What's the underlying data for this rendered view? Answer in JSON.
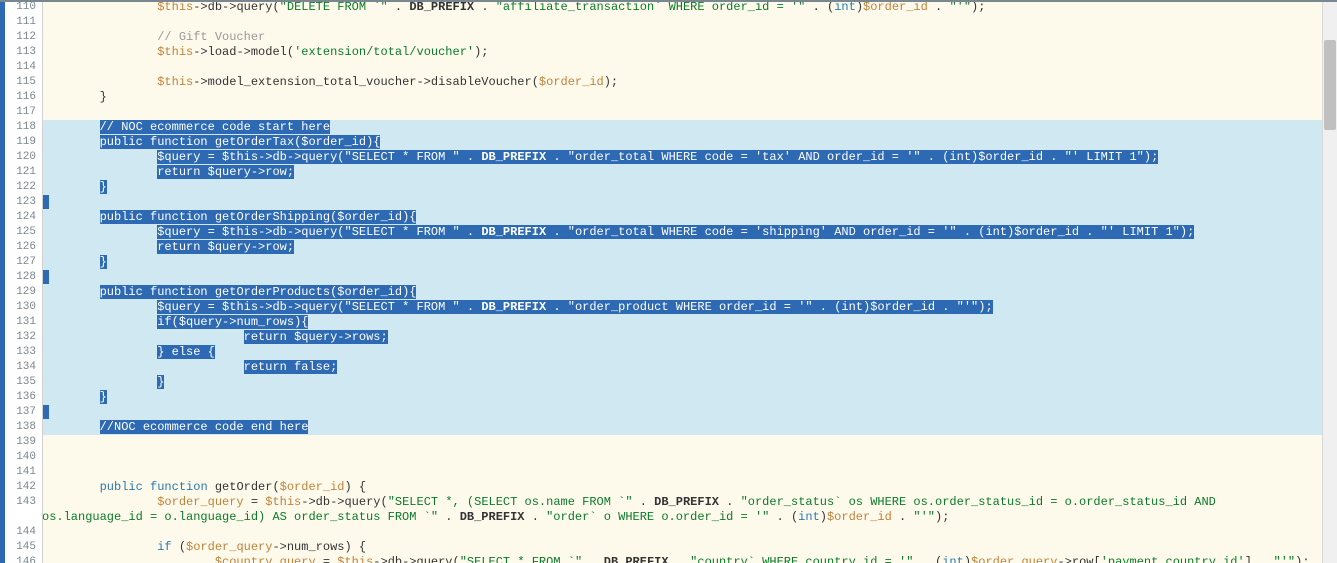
{
  "editor": {
    "first_line": 110,
    "selection_start": 118,
    "selection_end": 138,
    "lines": [
      {
        "n": 110,
        "indent": 16,
        "tokens": [
          [
            "var",
            "$this"
          ],
          [
            "op",
            "->"
          ],
          [
            "id",
            "db"
          ],
          [
            "op",
            "->"
          ],
          [
            "id",
            "query"
          ],
          [
            "op",
            "("
          ],
          [
            "str",
            "\"DELETE FROM `\""
          ],
          [
            "op",
            " . "
          ],
          [
            "const",
            "DB_PREFIX"
          ],
          [
            "op",
            " . "
          ],
          [
            "str",
            "\"affiliate_transaction` WHERE order_id = '\""
          ],
          [
            "op",
            " . ("
          ],
          [
            "kw",
            "int"
          ],
          [
            "op",
            ")"
          ],
          [
            "var",
            "$order_id"
          ],
          [
            "op",
            " . "
          ],
          [
            "str",
            "\"'\""
          ],
          [
            "op",
            ");"
          ]
        ]
      },
      {
        "n": 111,
        "indent": 0,
        "tokens": []
      },
      {
        "n": 112,
        "indent": 16,
        "tokens": [
          [
            "cm",
            "// Gift Voucher"
          ]
        ]
      },
      {
        "n": 113,
        "indent": 16,
        "tokens": [
          [
            "var",
            "$this"
          ],
          [
            "op",
            "->"
          ],
          [
            "id",
            "load"
          ],
          [
            "op",
            "->"
          ],
          [
            "id",
            "model"
          ],
          [
            "op",
            "("
          ],
          [
            "str",
            "'extension/total/voucher'"
          ],
          [
            "op",
            ");"
          ]
        ]
      },
      {
        "n": 114,
        "indent": 0,
        "tokens": []
      },
      {
        "n": 115,
        "indent": 16,
        "tokens": [
          [
            "var",
            "$this"
          ],
          [
            "op",
            "->"
          ],
          [
            "id",
            "model_extension_total_voucher"
          ],
          [
            "op",
            "->"
          ],
          [
            "id",
            "disableVoucher"
          ],
          [
            "op",
            "("
          ],
          [
            "var",
            "$order_id"
          ],
          [
            "op",
            ");"
          ]
        ]
      },
      {
        "n": 116,
        "indent": 8,
        "tokens": [
          [
            "op",
            "}"
          ]
        ]
      },
      {
        "n": 117,
        "indent": 0,
        "tokens": []
      },
      {
        "n": 118,
        "indent": 8,
        "hl": true,
        "tokens": [
          [
            "cm",
            "// NOC ecommerce code start here"
          ]
        ]
      },
      {
        "n": 119,
        "indent": 8,
        "hl": true,
        "tokens": [
          [
            "kw",
            "public function"
          ],
          [
            "txt",
            " "
          ],
          [
            "id",
            "getOrderTax"
          ],
          [
            "op",
            "("
          ],
          [
            "var",
            "$order_id"
          ],
          [
            "op",
            "){"
          ]
        ]
      },
      {
        "n": 120,
        "indent": 16,
        "hl": true,
        "tokens": [
          [
            "var",
            "$query"
          ],
          [
            "op",
            " = "
          ],
          [
            "var",
            "$this"
          ],
          [
            "op",
            "->"
          ],
          [
            "id",
            "db"
          ],
          [
            "op",
            "->"
          ],
          [
            "id",
            "query"
          ],
          [
            "op",
            "("
          ],
          [
            "str",
            "\"SELECT * FROM \""
          ],
          [
            "op",
            " . "
          ],
          [
            "const",
            "DB_PREFIX"
          ],
          [
            "op",
            " . "
          ],
          [
            "str",
            "\"order_total WHERE code = 'tax' AND order_id = '\""
          ],
          [
            "op",
            " . ("
          ],
          [
            "kw",
            "int"
          ],
          [
            "op",
            ")"
          ],
          [
            "var",
            "$order_id"
          ],
          [
            "op",
            " . "
          ],
          [
            "str",
            "\"' LIMIT 1\""
          ],
          [
            "op",
            ");"
          ]
        ]
      },
      {
        "n": 121,
        "indent": 16,
        "hl": true,
        "tokens": [
          [
            "kw",
            "return"
          ],
          [
            "txt",
            " "
          ],
          [
            "var",
            "$query"
          ],
          [
            "op",
            "->"
          ],
          [
            "id",
            "row"
          ],
          [
            "op",
            ";"
          ]
        ]
      },
      {
        "n": 122,
        "indent": 8,
        "hl": true,
        "tokens": [
          [
            "op",
            "}"
          ]
        ]
      },
      {
        "n": 123,
        "indent": 0,
        "hl": true,
        "tokens": []
      },
      {
        "n": 124,
        "indent": 8,
        "hl": true,
        "tokens": [
          [
            "kw",
            "public function"
          ],
          [
            "txt",
            " "
          ],
          [
            "id",
            "getOrderShipping"
          ],
          [
            "op",
            "("
          ],
          [
            "var",
            "$order_id"
          ],
          [
            "op",
            "){"
          ]
        ]
      },
      {
        "n": 125,
        "indent": 16,
        "hl": true,
        "tokens": [
          [
            "var",
            "$query"
          ],
          [
            "op",
            " = "
          ],
          [
            "var",
            "$this"
          ],
          [
            "op",
            "->"
          ],
          [
            "id",
            "db"
          ],
          [
            "op",
            "->"
          ],
          [
            "id",
            "query"
          ],
          [
            "op",
            "("
          ],
          [
            "str",
            "\"SELECT * FROM \""
          ],
          [
            "op",
            " . "
          ],
          [
            "const",
            "DB_PREFIX"
          ],
          [
            "op",
            " . "
          ],
          [
            "str",
            "\"order_total WHERE code = 'shipping' AND order_id = '\""
          ],
          [
            "op",
            " . ("
          ],
          [
            "kw",
            "int"
          ],
          [
            "op",
            ")"
          ],
          [
            "var",
            "$order_id"
          ],
          [
            "op",
            " . "
          ],
          [
            "str",
            "\"' LIMIT 1\""
          ],
          [
            "op",
            ");"
          ]
        ]
      },
      {
        "n": 126,
        "indent": 16,
        "hl": true,
        "tokens": [
          [
            "kw",
            "return"
          ],
          [
            "txt",
            " "
          ],
          [
            "var",
            "$query"
          ],
          [
            "op",
            "->"
          ],
          [
            "id",
            "row"
          ],
          [
            "op",
            ";"
          ]
        ]
      },
      {
        "n": 127,
        "indent": 8,
        "hl": true,
        "tokens": [
          [
            "op",
            "}"
          ]
        ]
      },
      {
        "n": 128,
        "indent": 0,
        "hl": true,
        "tokens": []
      },
      {
        "n": 129,
        "indent": 8,
        "hl": true,
        "tokens": [
          [
            "kw",
            "public function"
          ],
          [
            "txt",
            " "
          ],
          [
            "id",
            "getOrderProducts"
          ],
          [
            "op",
            "("
          ],
          [
            "var",
            "$order_id"
          ],
          [
            "op",
            "){"
          ]
        ]
      },
      {
        "n": 130,
        "indent": 16,
        "hl": true,
        "tokens": [
          [
            "var",
            "$query"
          ],
          [
            "op",
            " = "
          ],
          [
            "var",
            "$this"
          ],
          [
            "op",
            "->"
          ],
          [
            "id",
            "db"
          ],
          [
            "op",
            "->"
          ],
          [
            "id",
            "query"
          ],
          [
            "op",
            "("
          ],
          [
            "str",
            "\"SELECT * FROM \""
          ],
          [
            "op",
            " . "
          ],
          [
            "const",
            "DB_PREFIX"
          ],
          [
            "op",
            " . "
          ],
          [
            "str",
            "\"order_product WHERE order_id = '\""
          ],
          [
            "op",
            " . ("
          ],
          [
            "kw",
            "int"
          ],
          [
            "op",
            ")"
          ],
          [
            "var",
            "$order_id"
          ],
          [
            "op",
            " . "
          ],
          [
            "str",
            "\"'\""
          ],
          [
            "op",
            ");"
          ]
        ]
      },
      {
        "n": 131,
        "indent": 16,
        "hl": true,
        "tokens": [
          [
            "kw",
            "if"
          ],
          [
            "op",
            "("
          ],
          [
            "var",
            "$query"
          ],
          [
            "op",
            "->"
          ],
          [
            "id",
            "num_rows"
          ],
          [
            "op",
            "){"
          ]
        ]
      },
      {
        "n": 132,
        "indent": 28,
        "hl": true,
        "tokens": [
          [
            "kw",
            "return"
          ],
          [
            "txt",
            " "
          ],
          [
            "var",
            "$query"
          ],
          [
            "op",
            "->"
          ],
          [
            "id",
            "rows"
          ],
          [
            "op",
            ";"
          ]
        ]
      },
      {
        "n": 133,
        "indent": 16,
        "hl": true,
        "tokens": [
          [
            "op",
            "} "
          ],
          [
            "kw",
            "else"
          ],
          [
            "op",
            " {"
          ]
        ]
      },
      {
        "n": 134,
        "indent": 28,
        "hl": true,
        "tokens": [
          [
            "kw",
            "return false"
          ],
          [
            "op",
            ";"
          ]
        ]
      },
      {
        "n": 135,
        "indent": 16,
        "hl": true,
        "tokens": [
          [
            "op",
            "}"
          ]
        ]
      },
      {
        "n": 136,
        "indent": 8,
        "hl": true,
        "tokens": [
          [
            "op",
            "}"
          ]
        ]
      },
      {
        "n": 137,
        "indent": 0,
        "hl": true,
        "tokens": []
      },
      {
        "n": 138,
        "indent": 8,
        "hl": true,
        "tokens": [
          [
            "cm",
            "//NOC ecommerce code end here"
          ]
        ]
      },
      {
        "n": 139,
        "indent": 0,
        "tokens": []
      },
      {
        "n": 140,
        "indent": 0,
        "tokens": []
      },
      {
        "n": 141,
        "indent": 0,
        "tokens": []
      },
      {
        "n": 142,
        "indent": 8,
        "tokens": [
          [
            "kw",
            "public"
          ],
          [
            "txt",
            " "
          ],
          [
            "kw",
            "function"
          ],
          [
            "txt",
            " "
          ],
          [
            "id",
            "getOrder"
          ],
          [
            "op",
            "("
          ],
          [
            "var",
            "$order_id"
          ],
          [
            "op",
            ") {"
          ]
        ]
      },
      {
        "n": 143,
        "indent": 16,
        "tokens": [
          [
            "var",
            "$order_query"
          ],
          [
            "op",
            " = "
          ],
          [
            "var",
            "$this"
          ],
          [
            "op",
            "->"
          ],
          [
            "id",
            "db"
          ],
          [
            "op",
            "->"
          ],
          [
            "id",
            "query"
          ],
          [
            "op",
            "("
          ],
          [
            "str",
            "\"SELECT *, (SELECT os.name FROM `\""
          ],
          [
            "op",
            " . "
          ],
          [
            "const",
            "DB_PREFIX"
          ],
          [
            "op",
            " . "
          ],
          [
            "str",
            "\"order_status` os WHERE os.order_status_id = o.order_status_id AND os.language_id = o.language_id) AS order_status FROM `\""
          ],
          [
            "op",
            " . "
          ],
          [
            "const",
            "DB_PREFIX"
          ],
          [
            "op",
            " . "
          ],
          [
            "str",
            "\"order` o WHERE o.order_id = '\""
          ],
          [
            "op",
            " . ("
          ],
          [
            "kw",
            "int"
          ],
          [
            "op",
            ")"
          ],
          [
            "var",
            "$order_id"
          ],
          [
            "op",
            " . "
          ],
          [
            "str",
            "\"'\""
          ],
          [
            "op",
            ");"
          ]
        ]
      },
      {
        "n": 144,
        "indent": 0,
        "tokens": []
      },
      {
        "n": 145,
        "indent": 16,
        "tokens": [
          [
            "kw",
            "if"
          ],
          [
            "txt",
            " ("
          ],
          [
            "var",
            "$order_query"
          ],
          [
            "op",
            "->"
          ],
          [
            "id",
            "num_rows"
          ],
          [
            "op",
            ") {"
          ]
        ]
      },
      {
        "n": 146,
        "indent": 24,
        "tokens": [
          [
            "var",
            "$country_query"
          ],
          [
            "op",
            " = "
          ],
          [
            "var",
            "$this"
          ],
          [
            "op",
            "->"
          ],
          [
            "id",
            "db"
          ],
          [
            "op",
            "->"
          ],
          [
            "id",
            "query"
          ],
          [
            "op",
            "("
          ],
          [
            "str",
            "\"SELECT * FROM `\""
          ],
          [
            "op",
            " . "
          ],
          [
            "const",
            "DB_PREFIX"
          ],
          [
            "op",
            " . "
          ],
          [
            "str",
            "\"country` WHERE country_id = '\""
          ],
          [
            "op",
            " . ("
          ],
          [
            "kw",
            "int"
          ],
          [
            "op",
            ")"
          ],
          [
            "var",
            "$order_query"
          ],
          [
            "op",
            "->"
          ],
          [
            "id",
            "row"
          ],
          [
            "op",
            "["
          ],
          [
            "str",
            "'payment_country_id'"
          ],
          [
            "op",
            "] . "
          ],
          [
            "str",
            "\"'\""
          ],
          [
            "op",
            ");"
          ]
        ]
      }
    ]
  }
}
